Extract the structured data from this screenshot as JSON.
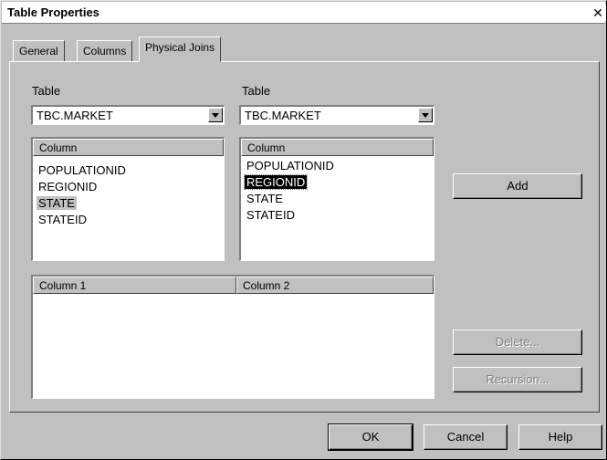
{
  "window": {
    "title": "Table Properties",
    "close_glyph": "✕"
  },
  "tabs": [
    {
      "label": "General"
    },
    {
      "label": "Columns"
    },
    {
      "label": "Physical Joins"
    }
  ],
  "left": {
    "table_label": "Table",
    "table_value": "TBC.MARKET",
    "column_header": "Column",
    "columns": [
      "POPULATIONID",
      "REGIONID",
      "STATE",
      "STATEID"
    ]
  },
  "right": {
    "table_label": "Table",
    "table_value": "TBC.MARKET",
    "column_header": "Column",
    "columns": [
      "POPULATIONID",
      "REGIONID",
      "STATE",
      "STATEID"
    ]
  },
  "joins": {
    "column1_header": "Column 1",
    "column2_header": "Column 2"
  },
  "buttons": {
    "add": "Add",
    "delete": "Delete...",
    "recursion": "Recursion...",
    "ok": "OK",
    "cancel": "Cancel",
    "help": "Help"
  }
}
